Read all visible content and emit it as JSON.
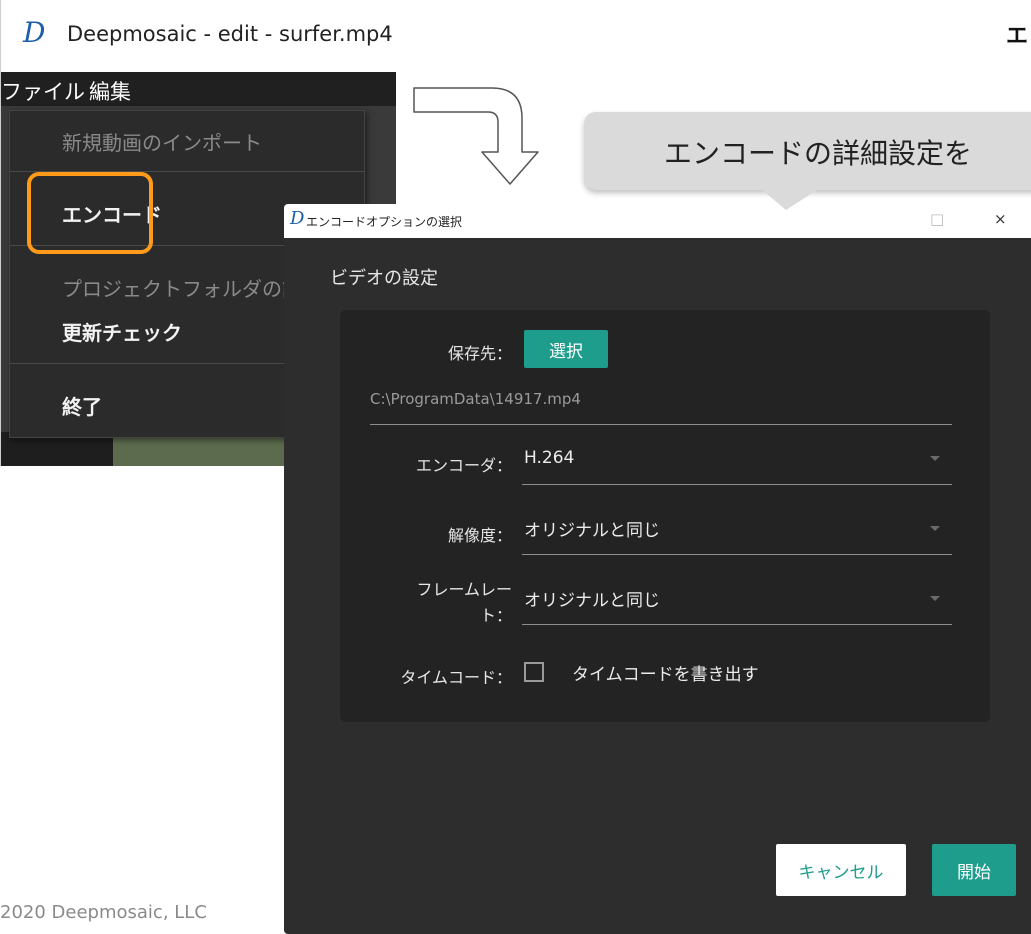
{
  "slide": {
    "heading": "エ",
    "copyright": "2020 Deepmosaic, LLC"
  },
  "app": {
    "logo": "D",
    "title": "Deepmosaic - edit - surfer.mp4",
    "menubar": [
      "ファイル",
      "編集"
    ],
    "file_menu": {
      "items": [
        {
          "label": "新規動画のインポート",
          "enabled": false
        },
        {
          "label": "エンコード",
          "enabled": true,
          "highlighted": true
        },
        {
          "label": "プロジェクトフォルダの設",
          "enabled": false
        },
        {
          "label": "更新チェック",
          "enabled": true
        },
        {
          "label": "終了",
          "enabled": true
        }
      ]
    }
  },
  "callout": {
    "text": "エンコードの詳細設定を"
  },
  "dialog": {
    "logo": "D",
    "title": "エンコードオプションの選択",
    "window_buttons": {
      "maximize": "□",
      "close": "×"
    },
    "section_title": "ビデオの設定",
    "save_to": {
      "label": "保存先：",
      "button": "選択",
      "path": "C:\\ProgramData\\14917.mp4"
    },
    "encoder": {
      "label": "エンコーダ：",
      "value": "H.264"
    },
    "resolution": {
      "label": "解像度：",
      "value": "オリジナルと同じ"
    },
    "framerate": {
      "label_line1": "フレームレー",
      "label_line2": "ト：",
      "value": "オリジナルと同じ"
    },
    "timecode": {
      "label": "タイムコード：",
      "checkbox_label": "タイムコードを書き出す",
      "checked": false
    },
    "buttons": {
      "cancel": "キャンセル",
      "start": "開始"
    }
  },
  "colors": {
    "accent": "#1e9d8c",
    "highlight": "#ff9a1a",
    "dialog_bg": "#2d2d2d",
    "panel_bg": "#232323"
  }
}
